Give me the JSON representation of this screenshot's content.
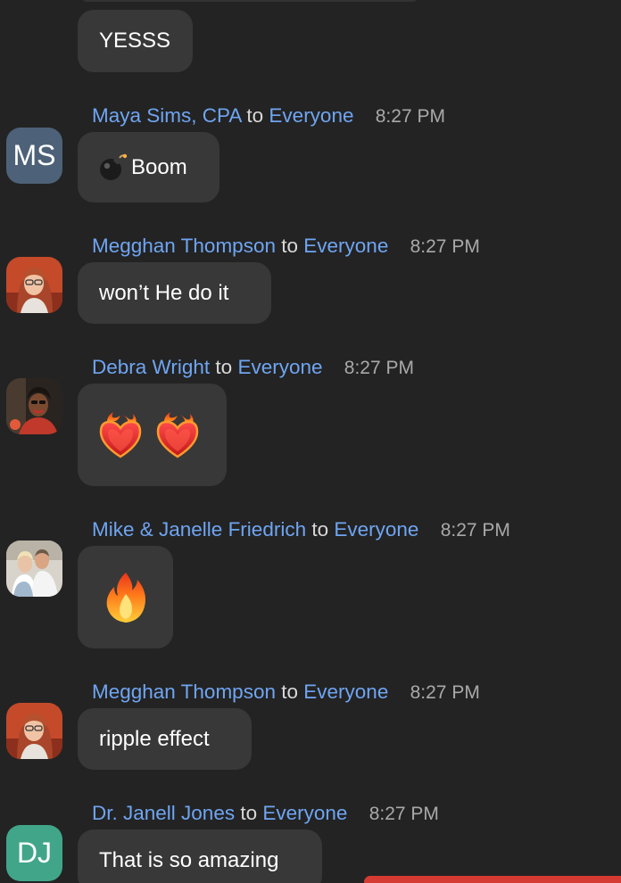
{
  "colors": {
    "background": "#232323",
    "bubble": "#383838",
    "name_blue": "#6fa5f2",
    "avatar_ms": "#4d6278",
    "avatar_dj": "#41a58a"
  },
  "messages": [
    {
      "text": "YESSS"
    },
    {
      "sender": "Maya Sims, CPA",
      "to": "to",
      "recipient": "Everyone",
      "time": "8:27 PM",
      "avatar_initials": "MS",
      "text": "Boom",
      "icon": "bomb-icon"
    },
    {
      "sender": "Megghan Thompson",
      "to": "to",
      "recipient": "Everyone",
      "time": "8:27 PM",
      "avatar": "photo",
      "text": "won’t He do it"
    },
    {
      "sender": "Debra Wright",
      "to": "to",
      "recipient": "Everyone",
      "time": "8:27 PM",
      "avatar": "photo",
      "emoji": [
        "heart-on-fire-icon",
        "heart-on-fire-icon"
      ]
    },
    {
      "sender": "Mike & Janelle Friedrich",
      "to": "to",
      "recipient": "Everyone",
      "time": "8:27 PM",
      "avatar": "photo",
      "emoji": [
        "fire-icon"
      ]
    },
    {
      "sender": "Megghan Thompson",
      "to": "to",
      "recipient": "Everyone",
      "time": "8:27 PM",
      "avatar": "photo",
      "text": "ripple effect"
    },
    {
      "sender": "Dr. Janell Jones",
      "to": "to",
      "recipient": "Everyone",
      "time": "8:27 PM",
      "avatar_initials": "DJ",
      "text": "That is so amazing"
    }
  ]
}
